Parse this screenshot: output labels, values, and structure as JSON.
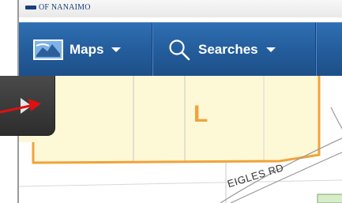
{
  "header": {
    "logo_text": "OF NANAIMO"
  },
  "toolbar": {
    "maps_label": "Maps",
    "maps_icon": "map-icon",
    "searches_label": "Searches",
    "searches_icon": "search-icon"
  },
  "map": {
    "parcel_label": "L",
    "road_label": "EIGLES RD"
  },
  "colors": {
    "toolbar_blue": "#245d9c",
    "parcel_fill": "#fdf8d6",
    "parcel_outline": "#f0a33a",
    "expand_button": "#3a3a3a",
    "annotation_arrow": "#e01010"
  }
}
